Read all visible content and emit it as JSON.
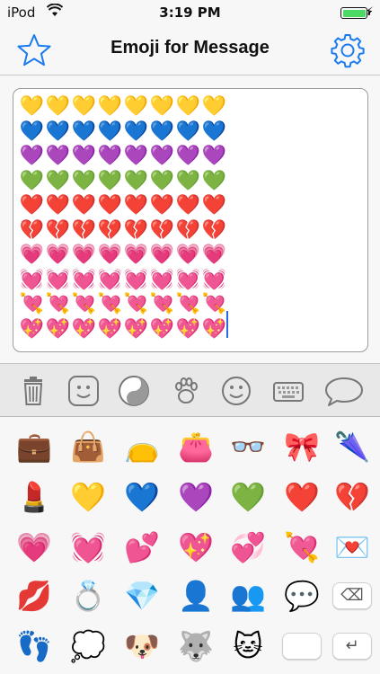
{
  "status_bar": {
    "carrier": "iPod",
    "time": "3:19 PM"
  },
  "nav": {
    "title": "Emoji for Message",
    "left_icon": "star-icon",
    "right_icon": "gear-icon",
    "accent": "#1a7bf0"
  },
  "message": {
    "rows": [
      [
        "💛",
        "💛",
        "💛",
        "💛",
        "💛",
        "💛",
        "💛",
        "💛"
      ],
      [
        "💙",
        "💙",
        "💙",
        "💙",
        "💙",
        "💙",
        "💙",
        "💙"
      ],
      [
        "💜",
        "💜",
        "💜",
        "💜",
        "💜",
        "💜",
        "💜",
        "💜"
      ],
      [
        "💚",
        "💚",
        "💚",
        "💚",
        "💚",
        "💚",
        "💚",
        "💚"
      ],
      [
        "❤️",
        "❤️",
        "❤️",
        "❤️",
        "❤️",
        "❤️",
        "❤️",
        "❤️"
      ],
      [
        "💔",
        "💔",
        "💔",
        "💔",
        "💔",
        "💔",
        "💔",
        "💔"
      ],
      [
        "💗",
        "💗",
        "💗",
        "💗",
        "💗",
        "💗",
        "💗",
        "💗"
      ],
      [
        "💓",
        "💓",
        "💓",
        "💓",
        "💓",
        "💓",
        "💓",
        "💓"
      ],
      [
        "💘",
        "💘",
        "💘",
        "💘",
        "💘",
        "💘",
        "💘",
        "💘"
      ],
      [
        "💖",
        "💖",
        "💖",
        "💖",
        "💖",
        "💖",
        "💖",
        "💖"
      ]
    ]
  },
  "categories": [
    {
      "name": "trash-icon"
    },
    {
      "name": "face-icon"
    },
    {
      "name": "yin-yang-icon"
    },
    {
      "name": "paw-icon"
    },
    {
      "name": "smiley-icon"
    },
    {
      "name": "keyboard-icon"
    },
    {
      "name": "speech-bubble-icon"
    }
  ],
  "emoji_grid": {
    "rows": [
      [
        "💼",
        "👜",
        "👝",
        "👛",
        "👓",
        "🎀",
        "🌂"
      ],
      [
        "💄",
        "💛",
        "💙",
        "💜",
        "💚",
        "❤️",
        "💔"
      ],
      [
        "💗",
        "💓",
        "💕",
        "💖",
        "💞",
        "💘",
        "💌"
      ],
      [
        "💋",
        "💍",
        "💎",
        "👤",
        "👥",
        "💬",
        "delete"
      ],
      [
        "👣",
        "💭",
        "🐶",
        "🐺",
        "🐱",
        "blank",
        "return"
      ]
    ]
  },
  "keys": {
    "delete_glyph": "⌫",
    "return_glyph": "↵"
  }
}
